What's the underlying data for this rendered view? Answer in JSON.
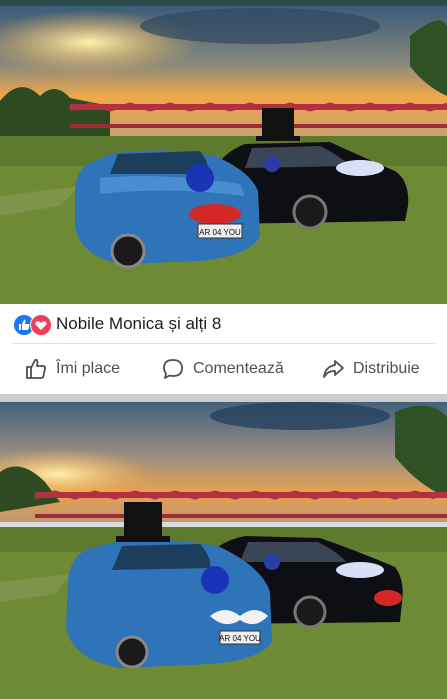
{
  "post": {
    "reactions": {
      "icons": [
        "like-icon",
        "love-icon"
      ],
      "summary": "Nobile Monica și alți 8"
    },
    "actions": {
      "like_label": "Îmi place",
      "comment_label": "Comentează",
      "share_label": "Distribuie"
    }
  },
  "photos": [
    {
      "plate": "AR 04 YOU"
    },
    {
      "plate": "AR 04 YOU"
    }
  ],
  "colors": {
    "like_blue": "#1877f2",
    "love_red": "#f33e58",
    "action_text": "#4b4f56"
  }
}
